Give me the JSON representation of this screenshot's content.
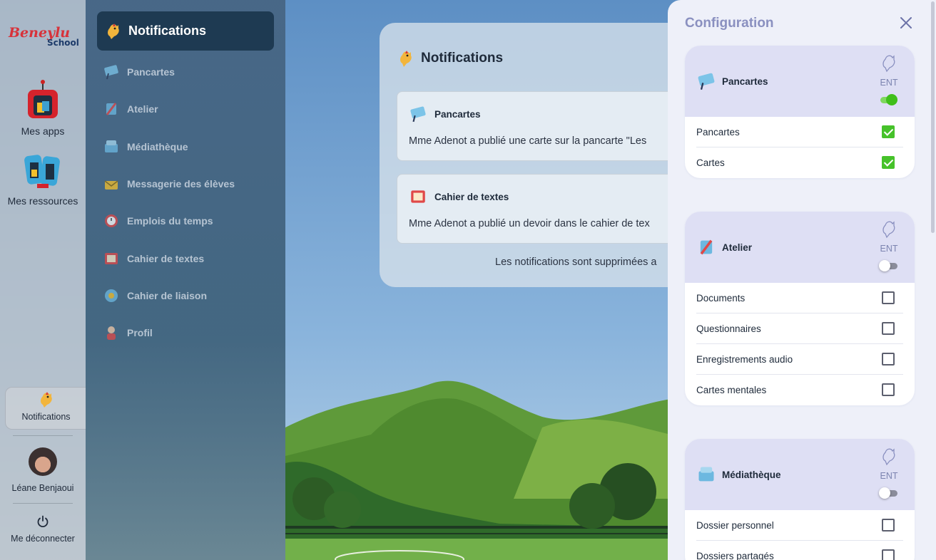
{
  "colors": {
    "drawer_bg": "#eef0f9",
    "section_head": "#dedff4",
    "accent_green": "#46c22a",
    "menu_head": "#1e3a52",
    "title_muted": "#8a90c0"
  },
  "rail": {
    "logo": "Beneylu School",
    "apps_label": "Mes apps",
    "resources_label": "Mes ressources",
    "notifications_label": "Notifications",
    "user_name": "Léane Benjaoui",
    "logout_label": "Me déconnecter"
  },
  "menu": {
    "title": "Notifications",
    "items": [
      {
        "label": "Pancartes",
        "icon": "signboard-icon"
      },
      {
        "label": "Atelier",
        "icon": "brush-icon"
      },
      {
        "label": "Médiathèque",
        "icon": "media-chest-icon"
      },
      {
        "label": "Messagerie des élèves",
        "icon": "mail-icon"
      },
      {
        "label": "Emplois du temps",
        "icon": "clock-icon"
      },
      {
        "label": "Cahier de textes",
        "icon": "notebook-icon"
      },
      {
        "label": "Cahier de liaison",
        "icon": "liaison-icon"
      },
      {
        "label": "Profil",
        "icon": "profile-icon"
      }
    ]
  },
  "notifications": {
    "title": "Notifications",
    "items": [
      {
        "app": "Pancartes",
        "text": "Mme Adenot a publié une carte sur la pancarte \"Les"
      },
      {
        "app": "Cahier de textes",
        "text": "Mme Adenot a publié un devoir dans le cahier de tex"
      }
    ],
    "footer": "Les notifications sont supprimées a"
  },
  "config": {
    "title": "Configuration",
    "ent_label": "ENT",
    "sections": [
      {
        "name": "Pancartes",
        "ent_enabled": true,
        "options": [
          {
            "label": "Pancartes",
            "checked": true
          },
          {
            "label": "Cartes",
            "checked": true
          }
        ]
      },
      {
        "name": "Atelier",
        "ent_enabled": false,
        "options": [
          {
            "label": "Documents",
            "checked": false
          },
          {
            "label": "Questionnaires",
            "checked": false
          },
          {
            "label": "Enregistrements audio",
            "checked": false
          },
          {
            "label": "Cartes mentales",
            "checked": false
          }
        ]
      },
      {
        "name": "Médiathèque",
        "ent_enabled": false,
        "options": [
          {
            "label": "Dossier personnel",
            "checked": false
          },
          {
            "label": "Dossiers partagés",
            "checked": false
          }
        ]
      }
    ]
  }
}
